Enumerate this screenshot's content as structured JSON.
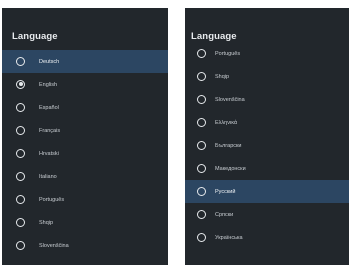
{
  "left_panel": {
    "title": "Language",
    "items": [
      {
        "label": "Deutsch",
        "selected": true,
        "checked": false
      },
      {
        "label": "English",
        "selected": false,
        "checked": true
      },
      {
        "label": "Español",
        "selected": false,
        "checked": false
      },
      {
        "label": "Français",
        "selected": false,
        "checked": false
      },
      {
        "label": "Hrvatski",
        "selected": false,
        "checked": false
      },
      {
        "label": "Italiano",
        "selected": false,
        "checked": false
      },
      {
        "label": "Português",
        "selected": false,
        "checked": false
      },
      {
        "label": "Shqip",
        "selected": false,
        "checked": false
      },
      {
        "label": "Slovenščina",
        "selected": false,
        "checked": false
      }
    ]
  },
  "right_panel": {
    "title": "Language",
    "items": [
      {
        "label": "Português",
        "selected": false,
        "checked": false
      },
      {
        "label": "Shqip",
        "selected": false,
        "checked": false
      },
      {
        "label": "Slovenščina",
        "selected": false,
        "checked": false
      },
      {
        "label": "Ελληνικά",
        "selected": false,
        "checked": false
      },
      {
        "label": "Български",
        "selected": false,
        "checked": false
      },
      {
        "label": "Македонски",
        "selected": false,
        "checked": false
      },
      {
        "label": "Русский",
        "selected": true,
        "checked": false
      },
      {
        "label": "Српски",
        "selected": false,
        "checked": false
      },
      {
        "label": "Українська",
        "selected": false,
        "checked": false
      }
    ]
  },
  "colors": {
    "panel_background": "#22272c",
    "highlight": "#2c4662",
    "text": "#c9ced3"
  }
}
